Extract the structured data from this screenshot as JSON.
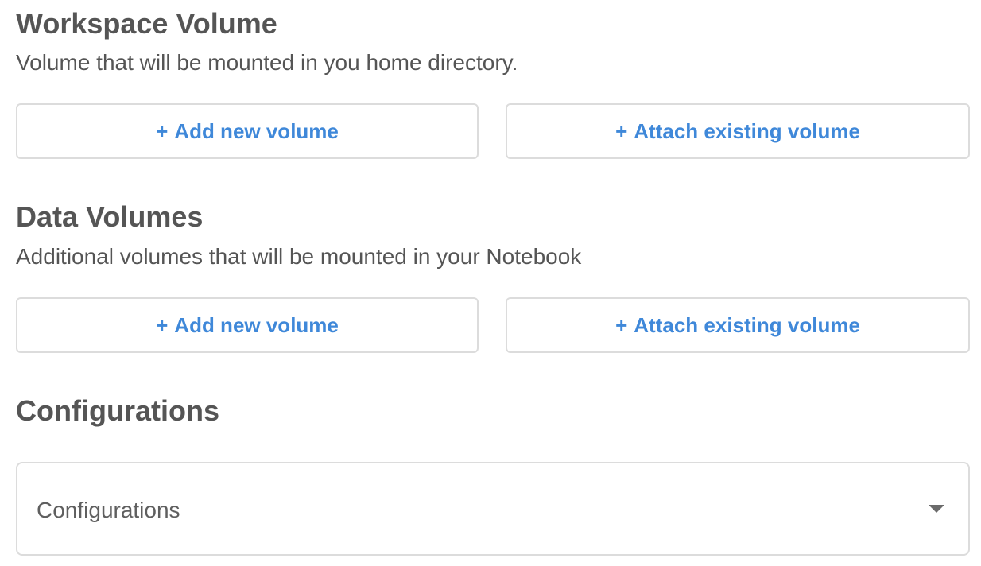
{
  "workspace": {
    "title": "Workspace Volume",
    "description": "Volume that will be mounted in you home directory.",
    "add_button": {
      "plus": "+",
      "label": "Add new volume"
    },
    "attach_button": {
      "plus": "+",
      "label": "Attach existing volume"
    }
  },
  "data_volumes": {
    "title": "Data Volumes",
    "description": "Additional volumes that will be mounted in your Notebook",
    "add_button": {
      "plus": "+",
      "label": "Add new volume"
    },
    "attach_button": {
      "plus": "+",
      "label": "Attach existing volume"
    }
  },
  "configurations": {
    "title": "Configurations",
    "select": {
      "placeholder": "Configurations",
      "icon": "caret-down-icon"
    }
  },
  "colors": {
    "accent": "#3f88d9",
    "text": "#555555",
    "border": "#dcdcdc"
  }
}
